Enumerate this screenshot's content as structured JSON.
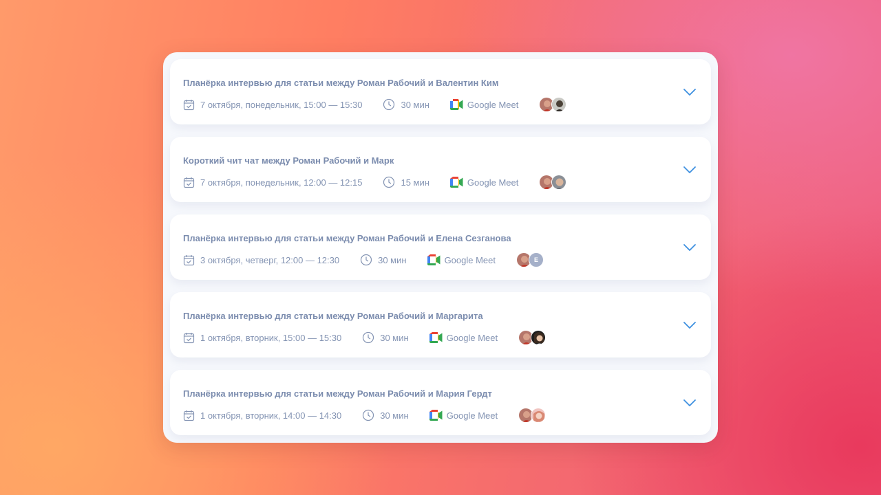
{
  "meetings": [
    {
      "title": "Планёрка интервью для статьи между Роман Рабочий и Валентин Ким",
      "date": "7 октября, понедельник, 15:00 — 15:30",
      "duration": "30 мин",
      "platform": "Google Meet",
      "participants": [
        "roman-photo",
        "valentin-photo"
      ]
    },
    {
      "title": "Короткий чит чат между Роман Рабочий и Марк",
      "date": "7 октября, понедельник, 12:00 — 12:15",
      "duration": "15 мин",
      "platform": "Google Meet",
      "participants": [
        "roman-photo",
        "mark-photo"
      ]
    },
    {
      "title": "Планёрка интервью для статьи между Роман Рабочий и Елена Сезганова",
      "date": "3 октября, четверг, 12:00 — 12:30",
      "duration": "30 мин",
      "platform": "Google Meet",
      "participants": [
        "roman-photo",
        "E"
      ]
    },
    {
      "title": "Планёрка интервью для статьи между Роман Рабочий и Маргарита",
      "date": "1 октября, вторник, 15:00 — 15:30",
      "duration": "30 мин",
      "platform": "Google Meet",
      "participants": [
        "roman-photo",
        "margarita-photo"
      ]
    },
    {
      "title": "Планёрка интервью для статьи между Роман Рабочий и Мария Гердт",
      "date": "1 октября, вторник, 14:00 — 14:30",
      "duration": "30 мин",
      "platform": "Google Meet",
      "participants": [
        "roman-photo",
        "maria-photo"
      ]
    }
  ],
  "icons": {
    "calendar": "calendar-check-icon",
    "duration": "clock-icon",
    "platform": "google-meet-icon",
    "expand": "chevron-down-icon"
  },
  "colors": {
    "title_text": "#7b8cae",
    "meta_text": "#8494b3",
    "chevron": "#3d8fe0",
    "letter_avatar_bg": "#a5b0c9"
  }
}
